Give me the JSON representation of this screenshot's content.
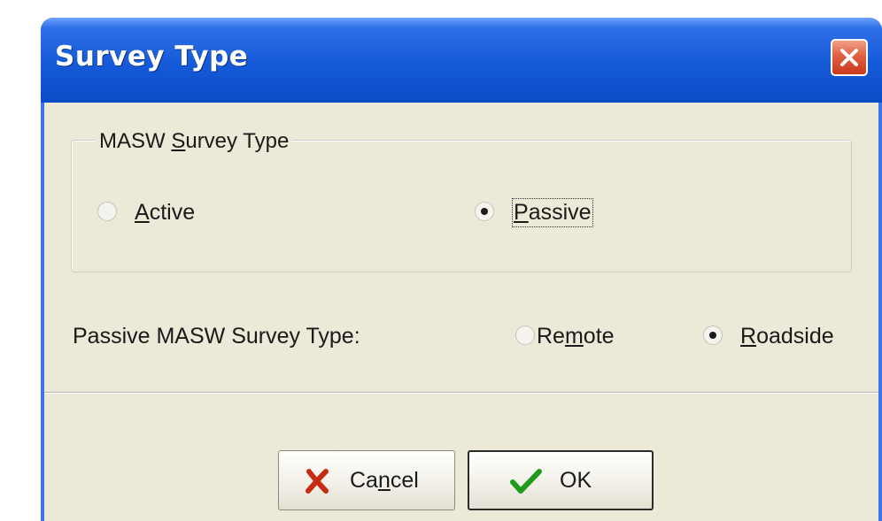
{
  "window": {
    "title": "Survey Type"
  },
  "group": {
    "legend_prefix": "MASW ",
    "legend_mnemonic": "S",
    "legend_suffix": "urvey Type"
  },
  "survey_type": {
    "options": [
      {
        "mnemonic": "A",
        "rest": "ctive",
        "selected": false
      },
      {
        "mnemonic": "P",
        "rest": "assive",
        "selected": true
      }
    ]
  },
  "passive": {
    "label": "Passive MASW Survey Type:",
    "options": [
      {
        "before": "Re",
        "mnemonic": "m",
        "after": "ote",
        "selected": false
      },
      {
        "before": "",
        "mnemonic": "R",
        "after": "oadside",
        "selected": true
      }
    ]
  },
  "buttons": {
    "cancel_prefix": "Ca",
    "cancel_mnemonic": "n",
    "cancel_suffix": "cel",
    "ok_label": "OK"
  },
  "icons": {
    "close": "close-icon",
    "cancel": "red-x-icon",
    "ok": "green-check-icon"
  },
  "colors": {
    "title_bar": "#165ad9",
    "client_bg": "#ece9d8",
    "close_button": "#e0603f",
    "cancel_icon": "#c62b12",
    "ok_icon": "#1f9a1a"
  }
}
